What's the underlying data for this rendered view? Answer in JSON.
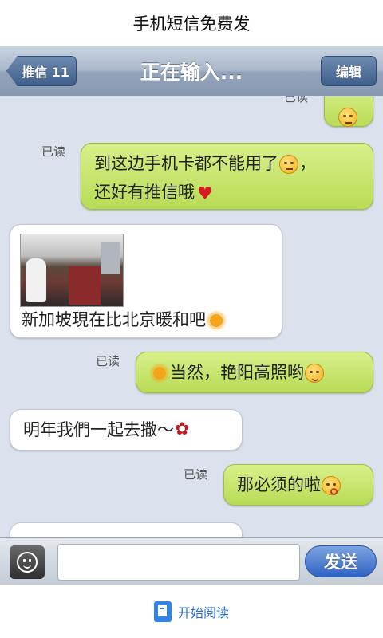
{
  "caption": "手机短信免费发",
  "navbar": {
    "back_label": "推信 11",
    "title": "正在输入...",
    "edit_label": "编辑"
  },
  "messages": [
    {
      "side": "out",
      "read_label": "已读",
      "text": "",
      "emoji": "sad-face"
    },
    {
      "side": "out",
      "read_label": "已读",
      "line1": "到这边手机卡都不能用了",
      "line1_tail": "，",
      "line2": "还好有推信哦",
      "emoji1": "crying-face",
      "emoji2": "heart"
    },
    {
      "side": "in",
      "text": "新加坡現在比北京暖和吧",
      "emoji": "sun",
      "has_photo": true
    },
    {
      "side": "out",
      "read_label": "已读",
      "text": "当然，艳阳高照哟",
      "emoji_before": "sun",
      "emoji": "wink-face"
    },
    {
      "side": "in",
      "text": "明年我們一起去撒～",
      "emoji": "rose"
    },
    {
      "side": "out",
      "read_label": "已读",
      "text": "那必须的啦",
      "emoji": "kiss-face"
    }
  ],
  "composer": {
    "placeholder": "",
    "send_label": "发送"
  },
  "footer": {
    "read_label": "开始阅读"
  },
  "colors": {
    "chat_bg": "#dbe2ed",
    "out_bubble": "#c8e66e",
    "in_bubble": "#ffffff",
    "nav_bar": "#9aabc1",
    "send_button": "#3a6fd0"
  }
}
